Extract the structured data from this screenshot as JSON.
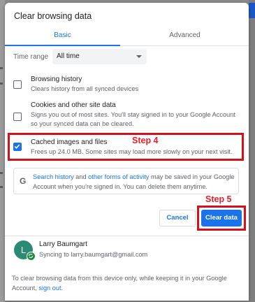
{
  "dialog": {
    "title": "Clear browsing data",
    "tabs": [
      {
        "label": "Basic",
        "active": true
      },
      {
        "label": "Advanced",
        "active": false
      }
    ],
    "time_range": {
      "label": "Time range",
      "selected": "All time"
    },
    "options": [
      {
        "title": "Browsing history",
        "description": "Clears history from all synced devices",
        "checked": false
      },
      {
        "title": "Cookies and other site data",
        "description": "Signs you out of most sites. You'll stay signed in to your Google Account so your synced data can be cleared.",
        "checked": false
      },
      {
        "title": "Cached images and files",
        "description": "Frees up 24.0 MB. Some sites may load more slowly on your next visit.",
        "checked": true
      }
    ],
    "info": {
      "icon": "google-g-icon",
      "link1": "Search history",
      "text1": " and ",
      "link2": "other forms of activity",
      "text2": " may be saved in your Google Account when you're signed in. You can delete them anytime."
    },
    "buttons": {
      "cancel": "Cancel",
      "clear": "Clear data"
    },
    "account": {
      "avatar_letter": "L",
      "name": "Larry Baumgart",
      "sync_status": "Syncing to larry.baumgart@gmail.com"
    },
    "footer": {
      "text": "To clear browsing data from this device only, while keeping it in your Google Account, ",
      "link": "sign out",
      "end": "."
    }
  },
  "annotations": {
    "step4": "Step 4",
    "step5": "Step 5"
  },
  "colors": {
    "accent": "#1a73e8",
    "annotation_red": "#d3111d",
    "avatar_green": "#2a8a73"
  }
}
